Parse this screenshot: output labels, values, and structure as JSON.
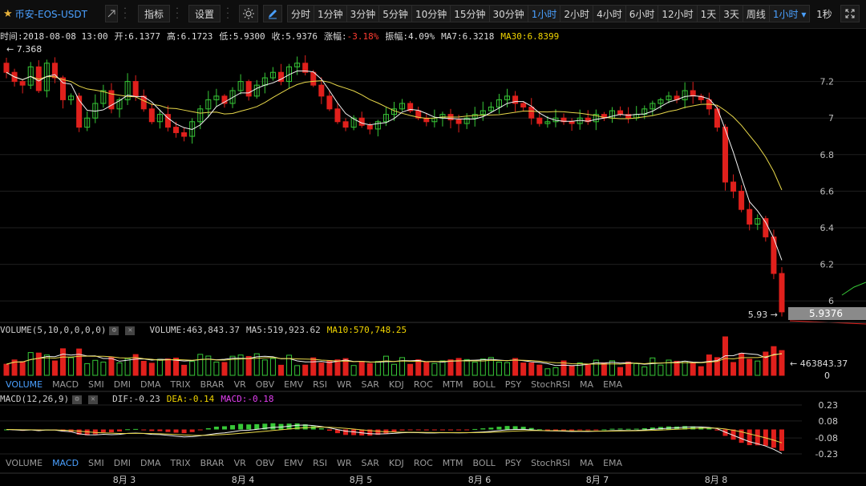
{
  "toolbar": {
    "symbol": "币安-EOS-USDT",
    "indicators_label": "指标",
    "settings_label": "设置",
    "periods": [
      "分时",
      "1分钟",
      "3分钟",
      "5分钟",
      "10分钟",
      "15分钟",
      "30分钟",
      "1小时",
      "2小时",
      "4小时",
      "6小时",
      "12小时",
      "1天",
      "3天",
      "周线",
      "1小时 ▾"
    ],
    "active_period_index": 7,
    "second_label": "1秒"
  },
  "info": {
    "time": "时间:2018-08-08 13:00",
    "open": "开:6.1377",
    "high": "高:6.1723",
    "low": "低:5.9300",
    "close": "收:5.9376",
    "change_label": "涨幅:",
    "change_value": "-3.18%",
    "amplitude": "振幅:4.09%",
    "ma7": "MA7:6.3218",
    "ma30": "MA30:6.8399"
  },
  "volume_info": {
    "name": "VOLUME(5,10,0,0,0,0)",
    "volume": "VOLUME:463,843.37",
    "ma5": "MA5:519,923.62",
    "ma10": "MA10:570,748.25"
  },
  "macd_info": {
    "name": "MACD(12,26,9)",
    "dif": "DIF:-0.23",
    "dea": "DEA:-0.14",
    "macd": "MACD:-0.18"
  },
  "tabs": [
    "VOLUME",
    "MACD",
    "SMI",
    "DMI",
    "DMA",
    "TRIX",
    "BRAR",
    "VR",
    "OBV",
    "EMV",
    "RSI",
    "WR",
    "SAR",
    "KDJ",
    "ROC",
    "MTM",
    "BOLL",
    "PSY",
    "StochRSI",
    "MA",
    "EMA"
  ],
  "colors": {
    "up": "#37c837",
    "down": "#e0201c",
    "ma_white": "#f2f2f2",
    "ma_yellow": "#e8d84a",
    "accent": "#4aa0ff"
  },
  "chart_data": {
    "type": "candlestick",
    "x_labels": [
      "8月 3",
      "8月 4",
      "8月 5",
      "8月 6",
      "8月 7",
      "8月 8"
    ],
    "price_ticks": [
      "7.2",
      "7",
      "6.8",
      "6.6",
      "6.4",
      "6.2",
      "6"
    ],
    "high_marker": "← 7.368",
    "low_marker": "5.93 →",
    "last_price": "5.9376",
    "volume_ticks": [
      "← 463843.37",
      "0"
    ],
    "macd_ticks": [
      "0.23",
      "0.08",
      "-0.08",
      "-0.23"
    ],
    "close_series": [
      7.25,
      7.2,
      7.18,
      7.28,
      7.15,
      7.3,
      7.22,
      7.1,
      7.12,
      6.95,
      7.0,
      7.08,
      7.15,
      7.05,
      7.1,
      7.2,
      7.12,
      7.05,
      6.98,
      7.02,
      6.95,
      6.92,
      6.9,
      6.98,
      7.05,
      7.1,
      7.12,
      7.08,
      7.15,
      7.2,
      7.12,
      7.18,
      7.22,
      7.25,
      7.2,
      7.28,
      7.3,
      7.25,
      7.18,
      7.12,
      7.05,
      6.98,
      6.95,
      7.0,
      6.96,
      6.94,
      6.98,
      7.02,
      7.05,
      7.08,
      7.04,
      7.0,
      6.98,
      7.0,
      7.02,
      6.99,
      6.97,
      7.0,
      7.02,
      7.04,
      7.06,
      7.1,
      7.12,
      7.08,
      7.06,
      7.0,
      6.97,
      6.98,
      7.0,
      6.98,
      6.97,
      7.0,
      6.98,
      7.02,
      7.0,
      7.04,
      7.02,
      7.0,
      7.02,
      7.05,
      7.08,
      7.1,
      7.12,
      7.1,
      7.15,
      7.12,
      7.1,
      7.05,
      6.95,
      6.65,
      6.6,
      6.5,
      6.42,
      6.45,
      6.35,
      6.15,
      5.94
    ]
  }
}
